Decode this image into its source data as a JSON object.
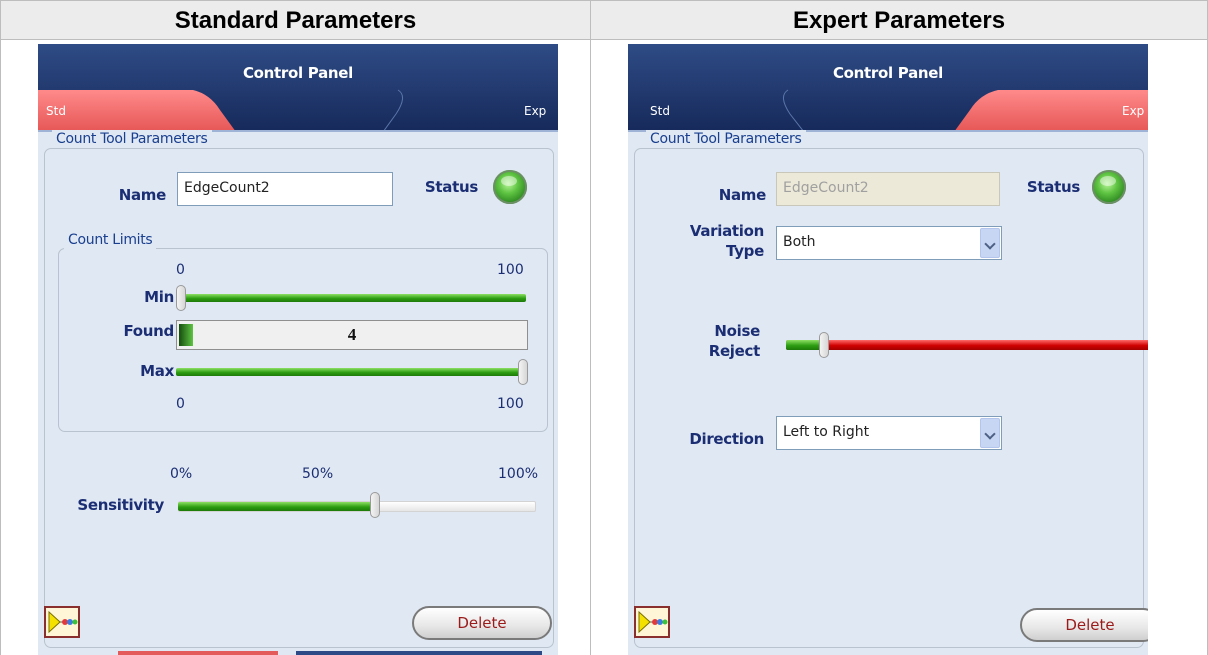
{
  "columns": {
    "standard_heading": "Standard Parameters",
    "expert_heading": "Expert Parameters"
  },
  "colors": {
    "header_navy": "#223a6d",
    "active_tab": "#ee7070",
    "panel_bg": "#dfe8f3",
    "label_navy": "#1c2e73"
  },
  "std": {
    "title": "Control Panel",
    "tab_std": "Std",
    "tab_exp": "Exp",
    "active_tab": "Std",
    "group_legend": "Count Tool Parameters",
    "name_label": "Name",
    "name_value": "EdgeCount2",
    "status_label": "Status",
    "status_color": "green",
    "count_limits_legend": "Count Limits",
    "range_min_top": "0",
    "range_max_top": "100",
    "min_label": "Min",
    "min_value": 0,
    "found_label": "Found",
    "found_value": "4",
    "max_label": "Max",
    "max_value": 100,
    "range_min_bottom": "0",
    "range_max_bottom": "100",
    "sens_tick_0": "0%",
    "sens_tick_50": "50%",
    "sens_tick_100": "100%",
    "sensitivity_label": "Sensitivity",
    "sensitivity_value_pct": 50,
    "delete_label": "Delete"
  },
  "exp": {
    "title": "Control Panel",
    "tab_std": "Std",
    "tab_exp": "Exp",
    "active_tab": "Exp",
    "group_legend": "Count Tool Parameters",
    "name_label": "Name",
    "name_value": "EdgeCount2",
    "status_label": "Status",
    "status_color": "green",
    "variation_label_1": "Variation",
    "variation_label_2": "Type",
    "variation_value": "Both",
    "noise_label_1": "Noise",
    "noise_label_2": "Reject",
    "noise_value_fraction": 0.1,
    "direction_label": "Direction",
    "direction_value": "Left to Right",
    "delete_label": "Delete"
  }
}
